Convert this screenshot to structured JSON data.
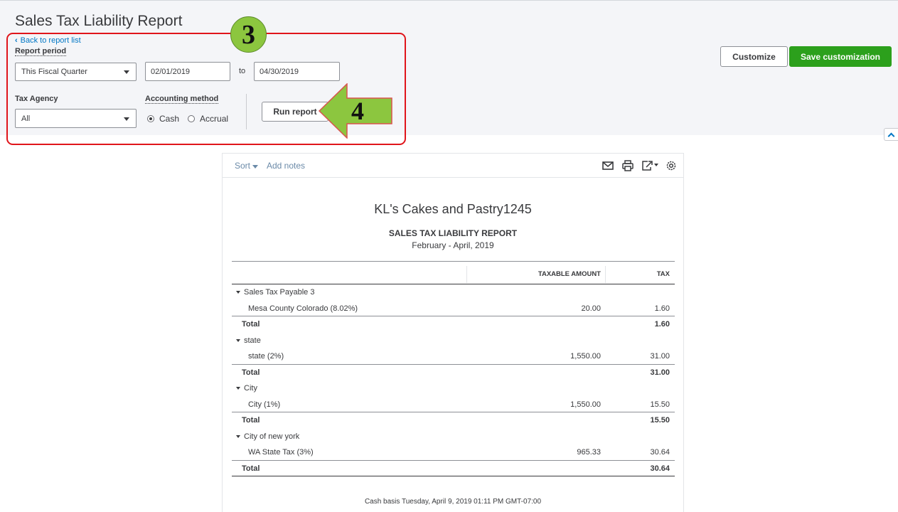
{
  "page": {
    "title": "Sales Tax Liability Report",
    "back_link": "Back to report list"
  },
  "filters": {
    "report_period_label": "Report period",
    "report_period_value": "This Fiscal Quarter",
    "date_from": "02/01/2019",
    "to_label": "to",
    "date_to": "04/30/2019",
    "tax_agency_label": "Tax Agency",
    "tax_agency_value": "All",
    "accounting_method_label": "Accounting method",
    "method_cash": "Cash",
    "method_accrual": "Accrual",
    "selected_method": "Cash",
    "run_report": "Run report"
  },
  "annotations": {
    "step3": "3",
    "step4": "4",
    "highlight_color": "#e0151b",
    "badge_color": "#8cc63f"
  },
  "actions": {
    "customize": "Customize",
    "save_customization": "Save customization",
    "accent_color": "#2ca01c"
  },
  "report": {
    "toolbar": {
      "sort": "Sort",
      "add_notes": "Add notes",
      "icons": [
        "email-icon",
        "print-icon",
        "export-icon",
        "settings-icon"
      ]
    },
    "company": "KL's Cakes and Pastry1245",
    "heading": "SALES TAX LIABILITY REPORT",
    "period": "February - April, 2019",
    "columns": {
      "taxable_amount": "TAXABLE AMOUNT",
      "tax": "TAX"
    },
    "rows": [
      {
        "type": "group",
        "label": "Sales Tax Payable 3"
      },
      {
        "type": "item",
        "label": "Mesa County Colorado (8.02%)",
        "amount": "20.00",
        "tax": "1.60"
      },
      {
        "type": "total",
        "label": "Total",
        "tax": "1.60"
      },
      {
        "type": "group",
        "label": "state"
      },
      {
        "type": "item",
        "label": "state (2%)",
        "amount": "1,550.00",
        "tax": "31.00"
      },
      {
        "type": "total",
        "label": "Total",
        "tax": "31.00"
      },
      {
        "type": "group",
        "label": "City"
      },
      {
        "type": "item",
        "label": "City (1%)",
        "amount": "1,550.00",
        "tax": "15.50"
      },
      {
        "type": "total",
        "label": "Total",
        "tax": "15.50"
      },
      {
        "type": "group",
        "label": "City of new york"
      },
      {
        "type": "item",
        "label": "WA State Tax (3%)",
        "amount": "965.33",
        "tax": "30.64"
      },
      {
        "type": "total",
        "label": "Total",
        "tax": "30.64"
      }
    ],
    "footer": "Cash basis   Tuesday, April 9, 2019   01:11 PM GMT-07:00"
  }
}
